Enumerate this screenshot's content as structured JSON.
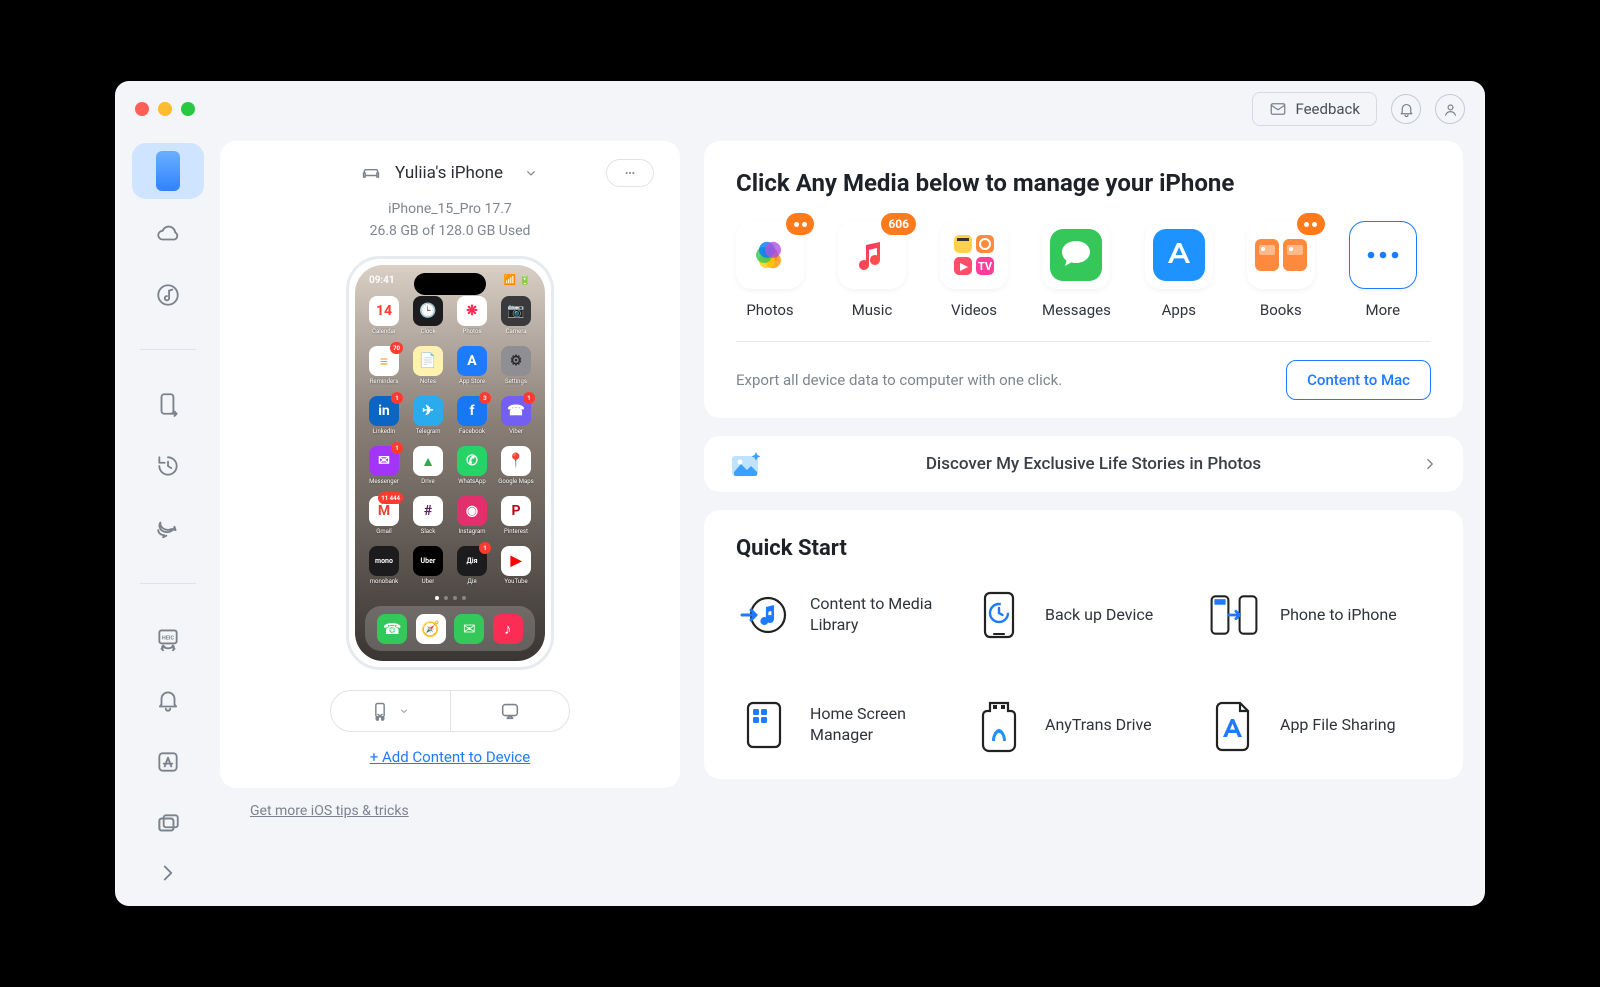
{
  "titlebar": {
    "feedback_label": "Feedback"
  },
  "sidebar": {
    "items": [
      {
        "name": "device-manager",
        "active": true,
        "icon": "phone-icon"
      },
      {
        "name": "icloud",
        "icon": "cloud-icon"
      },
      {
        "name": "itunes-library",
        "icon": "disc-note-icon"
      }
    ],
    "items2": [
      {
        "name": "transfer",
        "icon": "phone-arrow-icon"
      },
      {
        "name": "backup-restore",
        "icon": "history-icon"
      },
      {
        "name": "social",
        "icon": "chat-bubbles-icon"
      }
    ],
    "items3": [
      {
        "name": "heic-convert",
        "icon": "heic-icon"
      },
      {
        "name": "ringtone",
        "icon": "bell-icon"
      },
      {
        "name": "app-download",
        "icon": "appstore-icon"
      },
      {
        "name": "screen-mirror",
        "icon": "rects-icon"
      }
    ],
    "expand_icon": "chevron-right-icon"
  },
  "device": {
    "name": "Yuliia's iPhone",
    "model_line": "iPhone_15_Pro 17.7",
    "storage_line": "26.8 GB of  128.0 GB Used",
    "status_time": "09:41",
    "apps": [
      {
        "label": "Calendar",
        "emoji": "14",
        "bg": "#ffffff",
        "clr": "#ff3b30",
        "badge": ""
      },
      {
        "label": "Clock",
        "emoji": "🕒",
        "bg": "#1c1c1e",
        "clr": "#fff"
      },
      {
        "label": "Photos",
        "emoji": "❋",
        "bg": "#ffffff",
        "clr": "#ff2d55"
      },
      {
        "label": "Camera",
        "emoji": "📷",
        "bg": "#3a3a3c",
        "clr": "#e5e5ea"
      },
      {
        "label": "Reminders",
        "emoji": "≡",
        "bg": "#ffffff",
        "clr": "#ff9500",
        "badge": "70"
      },
      {
        "label": "Notes",
        "emoji": "📄",
        "bg": "#fff2b0",
        "clr": "#8e8e00"
      },
      {
        "label": "App Store",
        "emoji": "A",
        "bg": "#1e7bff",
        "clr": "#fff"
      },
      {
        "label": "Settings",
        "emoji": "⚙︎",
        "bg": "#8e8e93",
        "clr": "#2c2c2e"
      },
      {
        "label": "LinkedIn",
        "emoji": "in",
        "bg": "#0a66c2",
        "clr": "#fff",
        "badge": "1"
      },
      {
        "label": "Telegram",
        "emoji": "✈︎",
        "bg": "#2aabee",
        "clr": "#fff"
      },
      {
        "label": "Facebook",
        "emoji": "f",
        "bg": "#1877f2",
        "clr": "#fff",
        "badge": "3"
      },
      {
        "label": "Viber",
        "emoji": "☎︎",
        "bg": "#7360f2",
        "clr": "#fff",
        "badge": "1"
      },
      {
        "label": "Messenger",
        "emoji": "✉︎",
        "bg": "#a334fa",
        "clr": "#fff",
        "badge": "1"
      },
      {
        "label": "Drive",
        "emoji": "▲",
        "bg": "#ffffff",
        "clr": "#34a853"
      },
      {
        "label": "WhatsApp",
        "emoji": "✆",
        "bg": "#25d366",
        "clr": "#fff"
      },
      {
        "label": "Google Maps",
        "emoji": "📍",
        "bg": "#ffffff",
        "clr": "#ea4335"
      },
      {
        "label": "Gmail",
        "emoji": "M",
        "bg": "#ffffff",
        "clr": "#ea4335",
        "badge": "11 444"
      },
      {
        "label": "Slack",
        "emoji": "#",
        "bg": "#ffffff",
        "clr": "#611f69"
      },
      {
        "label": "Instagram",
        "emoji": "◉",
        "bg": "#e1306c",
        "clr": "#fff"
      },
      {
        "label": "Pinterest",
        "emoji": "P",
        "bg": "#ffffff",
        "clr": "#bd081c"
      },
      {
        "label": "monobank",
        "emoji": "mono",
        "bg": "#1c1c1e",
        "clr": "#fff"
      },
      {
        "label": "Uber",
        "emoji": "Uber",
        "bg": "#000000",
        "clr": "#fff"
      },
      {
        "label": "Дія",
        "emoji": "Дія",
        "bg": "#1c1c1e",
        "clr": "#fff",
        "badge": "1"
      },
      {
        "label": "YouTube",
        "emoji": "▶︎",
        "bg": "#ffffff",
        "clr": "#ff0000"
      }
    ],
    "dock": [
      {
        "bg": "#34c759",
        "emoji": "☎︎"
      },
      {
        "bg": "#ffffff",
        "emoji": "🧭"
      },
      {
        "bg": "#34c759",
        "emoji": "✉︎"
      },
      {
        "bg": "#fa2e54",
        "emoji": "♪"
      }
    ],
    "add_content_label": "+ Add Content to Device"
  },
  "main": {
    "heading": "Click Any Media below to manage your iPhone",
    "media": [
      {
        "name": "photos",
        "label": "Photos",
        "badge": "●●",
        "badge_dots": true
      },
      {
        "name": "music",
        "label": "Music",
        "badge": "606"
      },
      {
        "name": "videos",
        "label": "Videos"
      },
      {
        "name": "messages",
        "label": "Messages"
      },
      {
        "name": "apps",
        "label": "Apps"
      },
      {
        "name": "books",
        "label": "Books",
        "badge": "●●",
        "badge_dots": true
      },
      {
        "name": "more",
        "label": "More"
      }
    ],
    "export_text": "Export all device data to computer with one click.",
    "content_to_mac_label": "Content to Mac"
  },
  "promo": {
    "text": "Discover My Exclusive Life Stories in Photos"
  },
  "quick": {
    "heading": "Quick Start",
    "items": [
      {
        "name": "content-to-media",
        "label": "Content to Media Library"
      },
      {
        "name": "back-up-device",
        "label": "Back up Device"
      },
      {
        "name": "phone-to-iphone",
        "label": "Phone to iPhone"
      },
      {
        "name": "home-screen-manager",
        "label": "Home Screen Manager"
      },
      {
        "name": "anytrans-drive",
        "label": "AnyTrans Drive"
      },
      {
        "name": "app-file-sharing",
        "label": "App File Sharing"
      }
    ]
  },
  "footer": {
    "tips_link": "Get more iOS tips & tricks"
  }
}
